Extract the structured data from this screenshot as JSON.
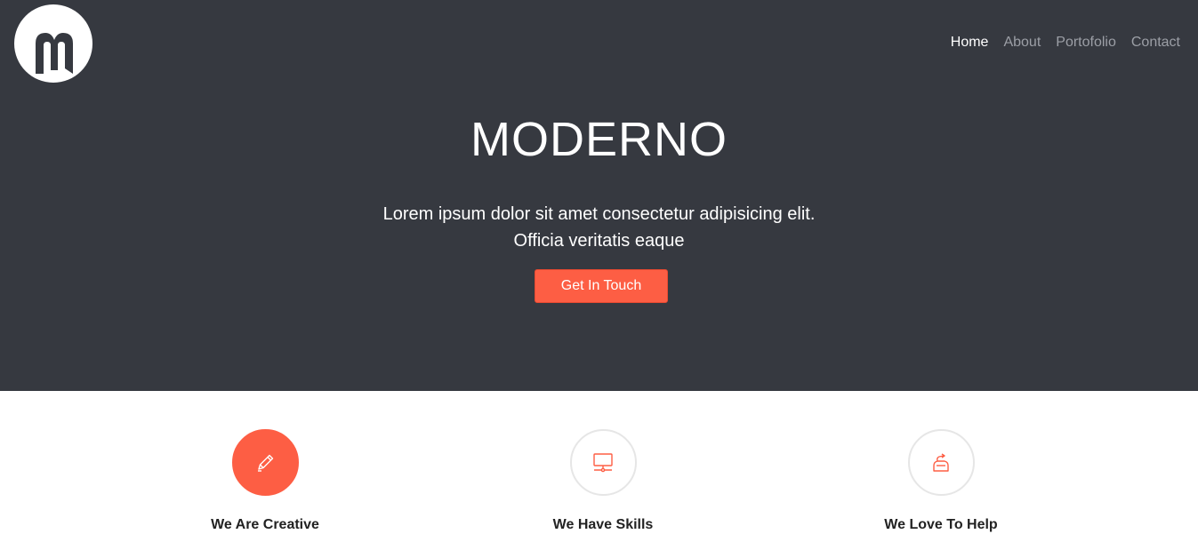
{
  "nav": {
    "items": [
      {
        "label": "Home",
        "active": true
      },
      {
        "label": "About",
        "active": false
      },
      {
        "label": "Portofolio",
        "active": false
      },
      {
        "label": "Contact",
        "active": false
      }
    ]
  },
  "hero": {
    "title": "MODERNO",
    "text_line1": "Lorem ipsum dolor sit amet consectetur adipisicing elit.",
    "text_line2": "Officia veritatis eaque",
    "cta_label": "Get In Touch"
  },
  "features": [
    {
      "icon": "pencil-icon",
      "title": "We Are Creative"
    },
    {
      "icon": "monitor-icon",
      "title": "We Have Skills"
    },
    {
      "icon": "help-icon",
      "title": "We Love To Help"
    }
  ],
  "colors": {
    "hero_bg": "#363940",
    "accent": "#fd5e44",
    "nav_inactive": "#9c9fa6"
  }
}
